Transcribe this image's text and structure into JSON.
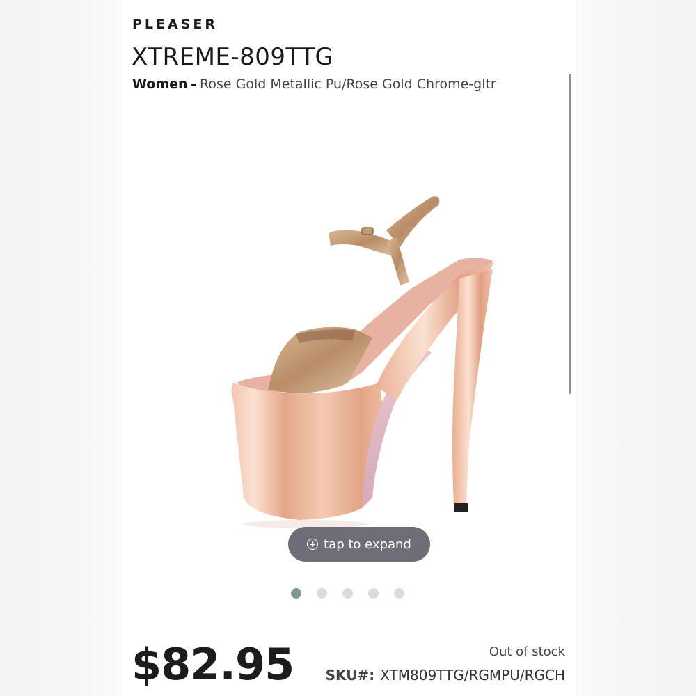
{
  "product": {
    "brand": "PLEASER",
    "name": "XTREME-809TTG",
    "gender": "Women",
    "separator": "–",
    "variant": "Rose Gold Metallic Pu/Rose Gold Chrome-gltr"
  },
  "gallery": {
    "expand_label": "tap to expand",
    "expand_icon": "plus-circle-icon",
    "image_subject": "rose gold platform sandal",
    "dots": [
      {
        "active": true
      },
      {
        "active": false
      },
      {
        "active": false
      },
      {
        "active": false
      },
      {
        "active": false
      }
    ]
  },
  "pricing": {
    "price": "$82.95",
    "stock_status": "Out of stock",
    "sku_label": "SKU#:",
    "sku_value": "XTM809TTG/RGMPU/RGCH"
  },
  "colors": {
    "rose_gold": "#e9b79f",
    "metallic_gold": "#c7a07c",
    "dot_active": "#7f9893",
    "dot_inactive": "#d9dcdc"
  }
}
